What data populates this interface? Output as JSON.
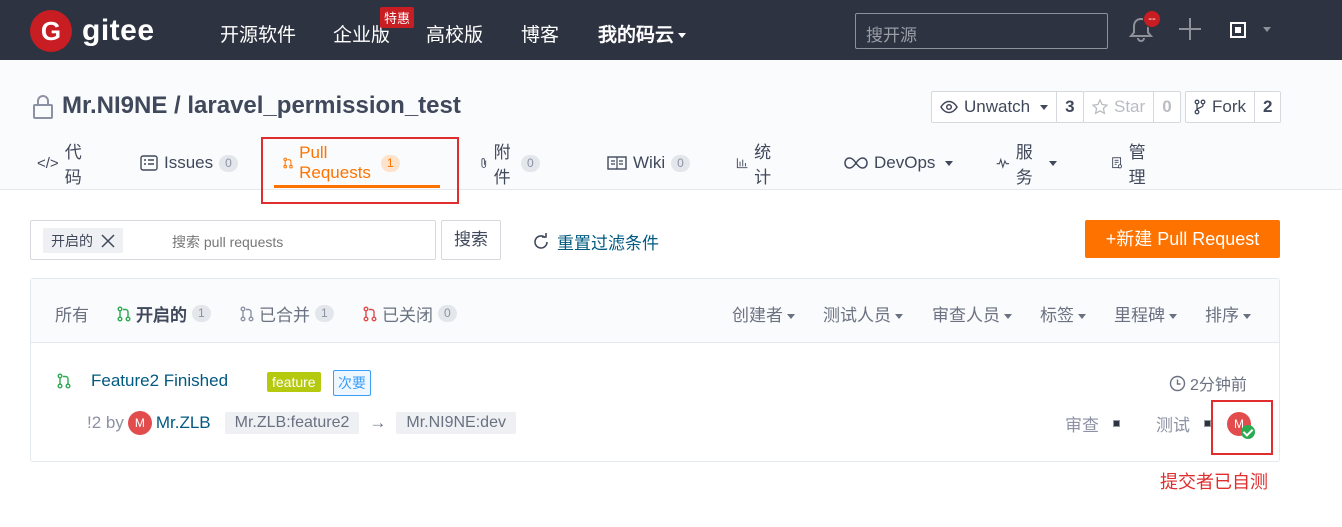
{
  "topnav": {
    "logo_text": "gitee",
    "logo_letter": "G",
    "items": [
      "开源软件",
      "企业版",
      "高校版",
      "博客",
      "我的码云"
    ],
    "badge": "特惠",
    "search_placeholder": "搜开源",
    "notify_count": "--"
  },
  "repo": {
    "title": "Mr.NI9NE / laravel_permission_test",
    "unwatch_label": "Unwatch",
    "unwatch_count": "3",
    "star_label": "Star",
    "star_count": "0",
    "fork_label": "Fork",
    "fork_count": "2"
  },
  "tabs": [
    {
      "label": "代码"
    },
    {
      "label": "Issues",
      "count": "0"
    },
    {
      "label": "Pull Requests",
      "count": "1"
    },
    {
      "label": "附件",
      "count": "0"
    },
    {
      "label": "Wiki",
      "count": "0"
    },
    {
      "label": "统计"
    },
    {
      "label": "DevOps"
    },
    {
      "label": "服务"
    },
    {
      "label": "管理"
    }
  ],
  "filter": {
    "chip": "开启的",
    "placeholder": "搜索 pull requests",
    "search_button": "搜索",
    "reset_label": "重置过滤条件",
    "new_pr_label": "+新建 Pull Request"
  },
  "states": [
    {
      "label": "所有"
    },
    {
      "label": "开启的",
      "count": "1"
    },
    {
      "label": "已合并",
      "count": "1"
    },
    {
      "label": "已关闭",
      "count": "0"
    }
  ],
  "dropdowns": [
    "创建者",
    "测试人员",
    "审查人员",
    "标签",
    "里程碑",
    "排序"
  ],
  "pr": {
    "title": "Feature2 Finished",
    "label_feature": "feature",
    "label_priority": "次要",
    "time": "2分钟前",
    "number": "!2 by",
    "avatar_letter": "M",
    "author": "Mr.ZLB",
    "source_branch": "Mr.ZLB:feature2",
    "arrow": "→",
    "target_branch": "Mr.NI9NE:dev",
    "reviewer_label": "审查",
    "tester_label": "测试"
  },
  "annotation": "提交者已自测",
  "colors": {
    "accent": "#fe7300",
    "nav_bg": "#2e3341",
    "brand_red": "#c71d23",
    "link": "#005980",
    "annotation": "#e02d2d"
  }
}
